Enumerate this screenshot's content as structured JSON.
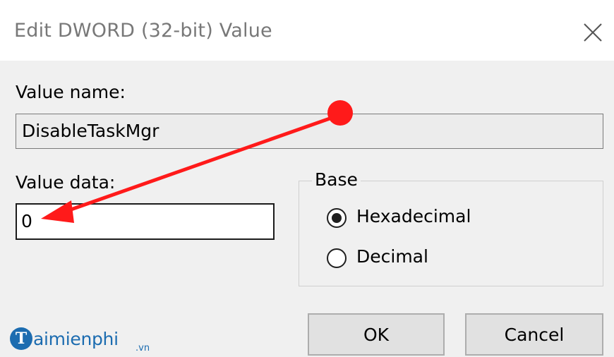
{
  "dialog": {
    "title": "Edit DWORD (32-bit) Value",
    "close_icon": "close-icon"
  },
  "value_name": {
    "label": "Value name:",
    "value": "DisableTaskMgr"
  },
  "value_data": {
    "label": "Value data:",
    "value": "0"
  },
  "base": {
    "title": "Base",
    "options": [
      {
        "label": "Hexadecimal",
        "selected": true
      },
      {
        "label": "Decimal",
        "selected": false
      }
    ]
  },
  "buttons": {
    "ok": "OK",
    "cancel": "Cancel"
  },
  "watermark": {
    "logo_letter": "T",
    "text": "aimienphi",
    "suffix": ".vn"
  },
  "annotation": {
    "arrow_color": "#ff1a1a"
  }
}
